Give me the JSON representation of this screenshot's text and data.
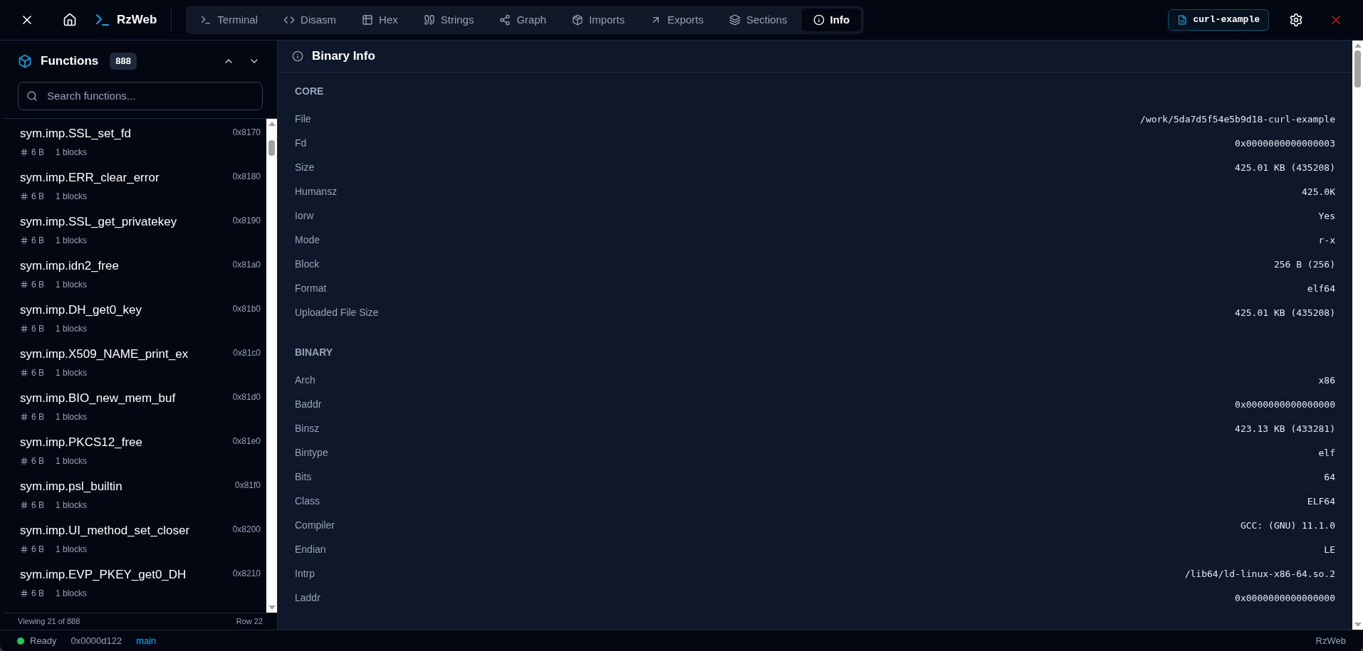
{
  "app": {
    "name": "RzWeb"
  },
  "tabs": [
    {
      "label": "Terminal",
      "kind": "terminal",
      "selected": false
    },
    {
      "label": "Disasm",
      "kind": "code",
      "selected": false
    },
    {
      "label": "Hex",
      "kind": "table",
      "selected": false
    },
    {
      "label": "Strings",
      "kind": "quote",
      "selected": false
    },
    {
      "label": "Graph",
      "kind": "graph",
      "selected": false
    },
    {
      "label": "Imports",
      "kind": "package",
      "selected": false
    },
    {
      "label": "Exports",
      "kind": "export",
      "selected": false
    },
    {
      "label": "Sections",
      "kind": "layers",
      "selected": false
    },
    {
      "label": "Info",
      "kind": "info",
      "selected": true
    }
  ],
  "file_badge": "curl-example",
  "sidebar": {
    "title": "Functions",
    "count": "888",
    "search": {
      "placeholder": "Search functions..."
    },
    "functions": [
      {
        "name": "sym.imp.SSL_set_fd",
        "address": "0x8170",
        "size": "6 B",
        "blocks": "1 blocks"
      },
      {
        "name": "sym.imp.ERR_clear_error",
        "address": "0x8180",
        "size": "6 B",
        "blocks": "1 blocks"
      },
      {
        "name": "sym.imp.SSL_get_privatekey",
        "address": "0x8190",
        "size": "6 B",
        "blocks": "1 blocks"
      },
      {
        "name": "sym.imp.idn2_free",
        "address": "0x81a0",
        "size": "6 B",
        "blocks": "1 blocks"
      },
      {
        "name": "sym.imp.DH_get0_key",
        "address": "0x81b0",
        "size": "6 B",
        "blocks": "1 blocks"
      },
      {
        "name": "sym.imp.X509_NAME_print_ex",
        "address": "0x81c0",
        "size": "6 B",
        "blocks": "1 blocks"
      },
      {
        "name": "sym.imp.BIO_new_mem_buf",
        "address": "0x81d0",
        "size": "6 B",
        "blocks": "1 blocks"
      },
      {
        "name": "sym.imp.PKCS12_free",
        "address": "0x81e0",
        "size": "6 B",
        "blocks": "1 blocks"
      },
      {
        "name": "sym.imp.psl_builtin",
        "address": "0x81f0",
        "size": "6 B",
        "blocks": "1 blocks"
      },
      {
        "name": "sym.imp.UI_method_set_closer",
        "address": "0x8200",
        "size": "6 B",
        "blocks": "1 blocks"
      },
      {
        "name": "sym.imp.EVP_PKEY_get0_DH",
        "address": "0x8210",
        "size": "6 B",
        "blocks": "1 blocks"
      }
    ],
    "footer": {
      "viewing": "Viewing 21 of 888",
      "row": "Row 22"
    }
  },
  "panel": {
    "title": "Binary Info",
    "sections": [
      {
        "title": "CORE",
        "rows": [
          {
            "key": "File",
            "value": "/work/5da7d5f54e5b9d18-curl-example"
          },
          {
            "key": "Fd",
            "value": "0x0000000000000003"
          },
          {
            "key": "Size",
            "value": "425.01 KB (435208)"
          },
          {
            "key": "Humansz",
            "value": "425.0K"
          },
          {
            "key": "Iorw",
            "value": "Yes"
          },
          {
            "key": "Mode",
            "value": "r-x"
          },
          {
            "key": "Block",
            "value": "256 B (256)"
          },
          {
            "key": "Format",
            "value": "elf64"
          },
          {
            "key": "Uploaded File Size",
            "value": "425.01 KB (435208)"
          }
        ]
      },
      {
        "title": "BINARY",
        "rows": [
          {
            "key": "Arch",
            "value": "x86"
          },
          {
            "key": "Baddr",
            "value": "0x0000000000000000"
          },
          {
            "key": "Binsz",
            "value": "423.13 KB (433281)"
          },
          {
            "key": "Bintype",
            "value": "elf"
          },
          {
            "key": "Bits",
            "value": "64"
          },
          {
            "key": "Class",
            "value": "ELF64"
          },
          {
            "key": "Compiler",
            "value": "GCC: (GNU) 11.1.0"
          },
          {
            "key": "Endian",
            "value": "LE"
          },
          {
            "key": "Intrp",
            "value": "/lib64/ld-linux-x86-64.so.2"
          },
          {
            "key": "Laddr",
            "value": "0x0000000000000000"
          }
        ]
      }
    ]
  },
  "status_bar": {
    "state": "Ready",
    "ready": true,
    "address": "0x0000d122",
    "function": "main",
    "app": "RzWeb"
  }
}
